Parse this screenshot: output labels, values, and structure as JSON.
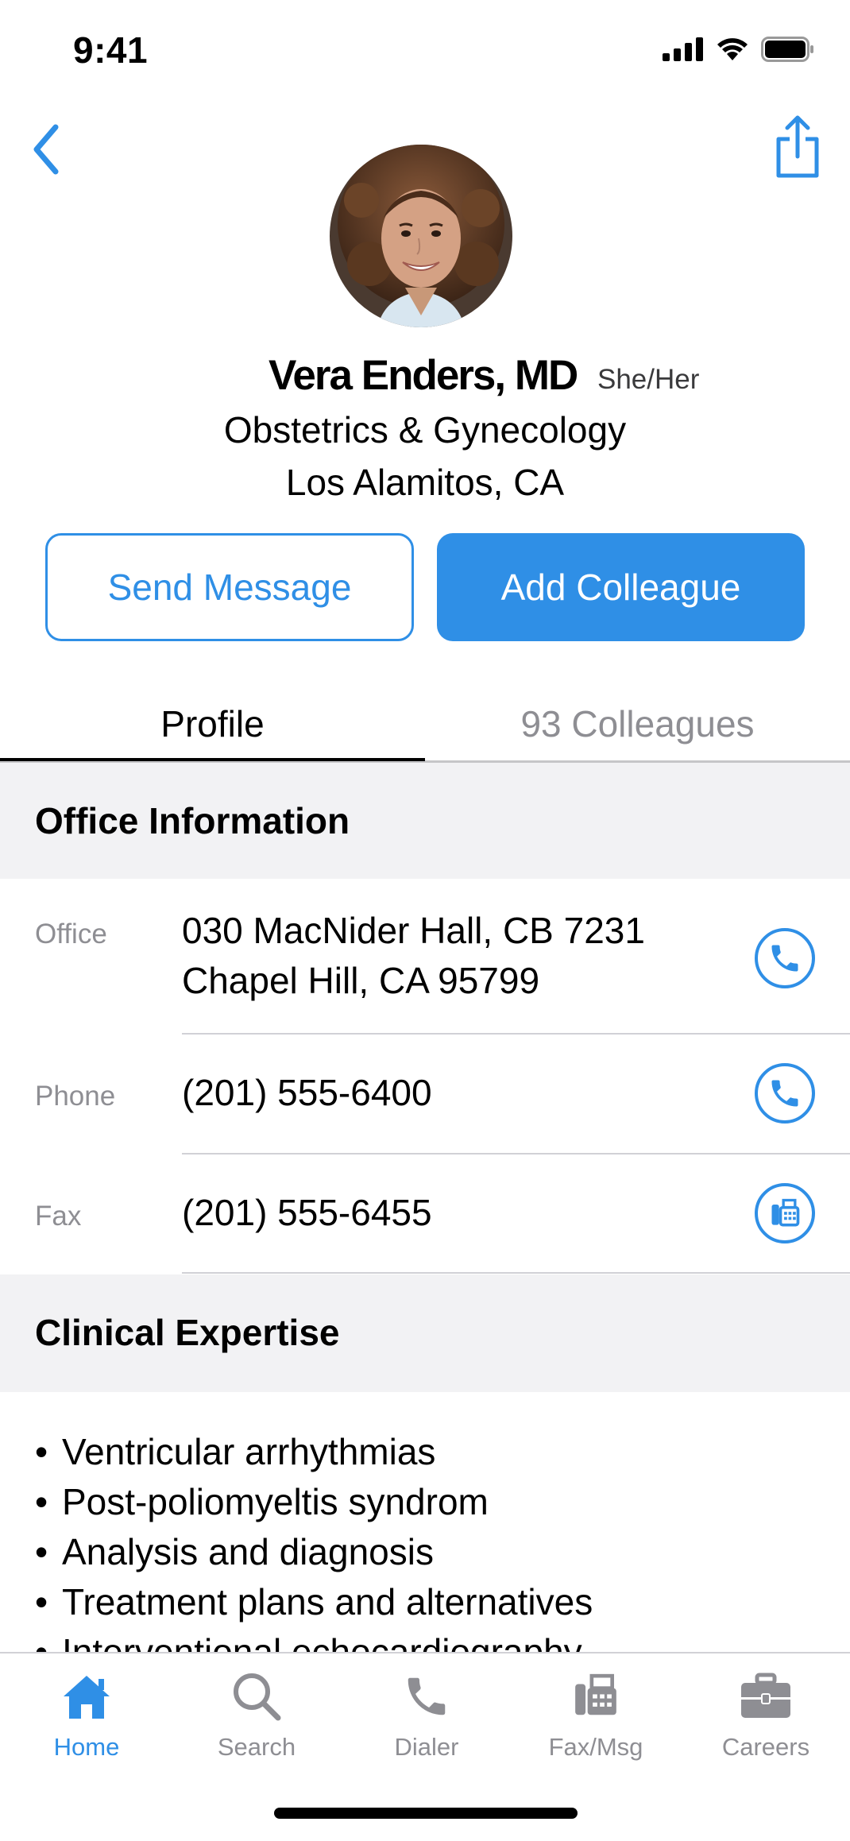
{
  "status_bar": {
    "time": "9:41",
    "icons": [
      "cellular-signal-icon",
      "wifi-icon",
      "battery-icon"
    ]
  },
  "nav": {
    "back_icon": "chevron-left-icon",
    "share_icon": "share-icon"
  },
  "profile": {
    "name": "Vera Enders, MD",
    "pronouns": "She/Her",
    "specialty": "Obstetrics & Gynecology",
    "location": "Los Alamitos, CA"
  },
  "actions": {
    "send_message": "Send Message",
    "add_colleague": "Add Colleague"
  },
  "tabs": [
    {
      "label": "Profile",
      "selected": true
    },
    {
      "label": "93 Colleagues",
      "selected": false
    }
  ],
  "office_section": {
    "title": "Office Information",
    "rows": [
      {
        "label": "Office",
        "line1": "030 MacNider Hall, CB 7231",
        "line2": "Chapel Hill, CA  95799",
        "action_icon": "phone-icon"
      },
      {
        "label": "Phone",
        "value": "(201) 555-6400",
        "action_icon": "phone-icon"
      },
      {
        "label": "Fax",
        "value": "(201) 555-6455",
        "action_icon": "fax-icon"
      }
    ]
  },
  "clinical_section": {
    "title": "Clinical Expertise",
    "items": [
      "Ventricular arrhythmias",
      "Post-poliomyeltis syndrom",
      "Analysis and diagnosis",
      "Treatment plans and alternatives",
      "Interventional echocardiography"
    ]
  },
  "tab_bar": [
    {
      "label": "Home",
      "icon": "home-icon",
      "active": true
    },
    {
      "label": "Search",
      "icon": "search-icon",
      "active": false
    },
    {
      "label": "Dialer",
      "icon": "phone-icon",
      "active": false
    },
    {
      "label": "Fax/Msg",
      "icon": "fax-icon",
      "active": false
    },
    {
      "label": "Careers",
      "icon": "briefcase-icon",
      "active": false
    }
  ],
  "colors": {
    "accent": "#2f8fe6",
    "inactive": "#8e8e93",
    "section_bg": "#f2f2f4"
  }
}
